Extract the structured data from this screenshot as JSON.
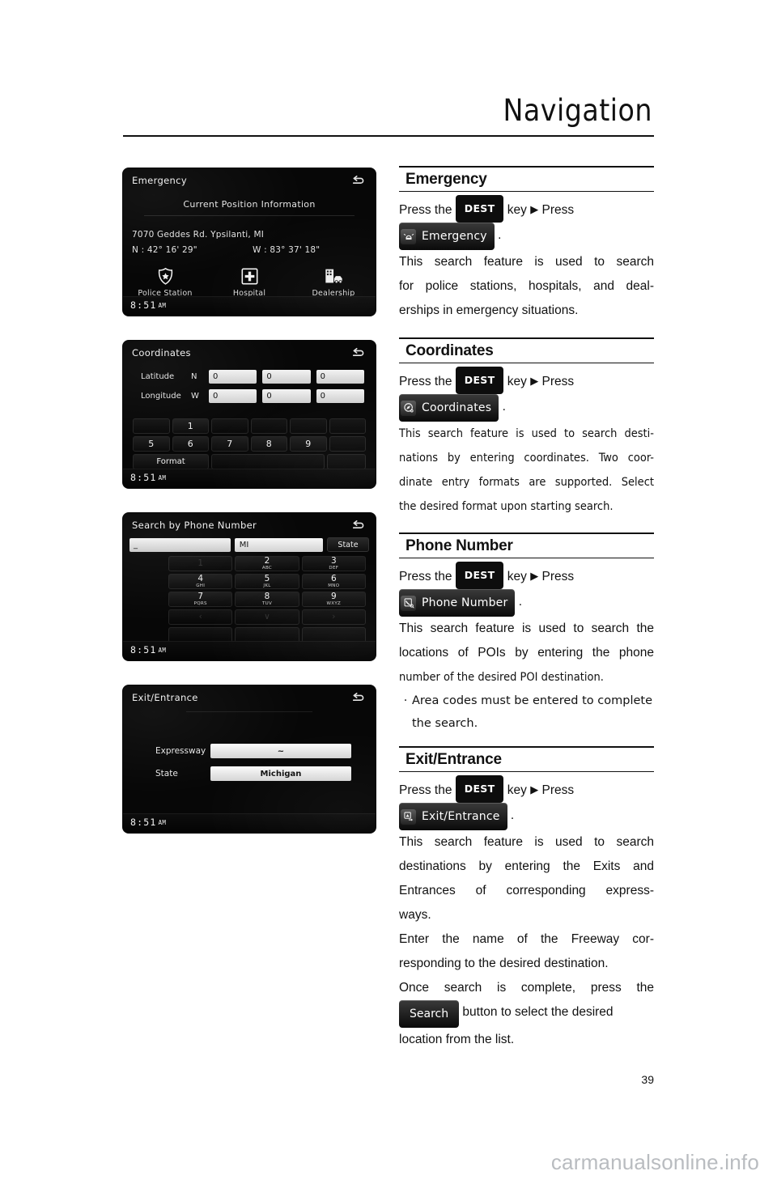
{
  "page": {
    "title": "Navigation",
    "number": "39",
    "watermark": "carmanualsonline.info"
  },
  "shots": {
    "emergency": {
      "title": "Emergency",
      "subtitle": "Current Position Information",
      "address": "7070 Geddes Rd. Ypsilanti, MI",
      "latitude": "N : 42° 16' 29\"",
      "longitude": "W : 83° 37' 18\"",
      "clock": "8:51",
      "clock_ampm": "AM",
      "items": [
        {
          "label": "Police Station",
          "icon": "police-badge-icon"
        },
        {
          "label": "Hospital",
          "icon": "hospital-cross-icon"
        },
        {
          "label": "Dealership",
          "icon": "dealership-icon"
        }
      ],
      "back_icon": "back-arrow-icon"
    },
    "coordinates": {
      "title": "Coordinates",
      "clock": "8:51",
      "clock_ampm": "AM",
      "rows": [
        {
          "label": "Latitude",
          "dir": "N",
          "values": [
            "0",
            "0",
            "0"
          ]
        },
        {
          "label": "Longitude",
          "dir": "W",
          "values": [
            "0",
            "0",
            "0"
          ]
        }
      ],
      "keypad_row1": [
        "",
        "1",
        "",
        "",
        "",
        ""
      ],
      "keypad_row2": [
        "5",
        "6",
        "7",
        "8",
        "9",
        ""
      ],
      "format_label": "Format",
      "back_icon": "back-arrow-icon"
    },
    "phone": {
      "title": "Search by Phone Number",
      "number_value": "_",
      "state_value": "MI",
      "state_button": "State",
      "clock": "8:51",
      "clock_ampm": "AM",
      "keys": [
        {
          "num": "1",
          "sub": "",
          "dim": true
        },
        {
          "num": "2",
          "sub": "ABC",
          "dim": false
        },
        {
          "num": "3",
          "sub": "DEF",
          "dim": false
        },
        {
          "num": "4",
          "sub": "GHI",
          "dim": false
        },
        {
          "num": "5",
          "sub": "JKL",
          "dim": false
        },
        {
          "num": "6",
          "sub": "MNO",
          "dim": false
        },
        {
          "num": "7",
          "sub": "PQRS",
          "dim": false
        },
        {
          "num": "8",
          "sub": "TUV",
          "dim": false
        },
        {
          "num": "9",
          "sub": "WXYZ",
          "dim": false
        },
        {
          "num": "‹",
          "sub": "",
          "dim": true
        },
        {
          "num": "∨",
          "sub": "",
          "dim": true
        },
        {
          "num": "›",
          "sub": "",
          "dim": true
        }
      ],
      "back_icon": "back-arrow-icon"
    },
    "exit_entrance": {
      "title": "Exit/Entrance",
      "clock": "8:51",
      "clock_ampm": "AM",
      "rows": [
        {
          "label": "Expressway",
          "value": "~"
        },
        {
          "label": "State",
          "value": "Michigan"
        }
      ],
      "back_icon": "back-arrow-icon"
    }
  },
  "sections": {
    "emergency": {
      "heading": "Emergency",
      "press_the": "Press the",
      "dest_key": "DEST",
      "key_word": "key",
      "arrow": "▶",
      "press2": "Press",
      "badge_label": "Emergency",
      "badge_icon": "siren-icon",
      "period": ".",
      "lines": [
        "This search feature is used to search",
        "for police stations, hospitals, and deal-",
        "erships in emergency situations."
      ]
    },
    "coordinates": {
      "heading": "Coordinates",
      "press_the": "Press the",
      "dest_key": "DEST",
      "key_word": "key",
      "arrow": "▶",
      "press2": "Press",
      "badge_label": "Coordinates",
      "badge_icon": "compass-icon",
      "period": ".",
      "lines": [
        "This search feature is used to search desti-",
        "nations by entering coordinates. Two coor-",
        "dinate entry formats are supported. Select",
        "the desired format upon starting search."
      ]
    },
    "phone_number": {
      "heading": "Phone Number",
      "press_the": "Press the",
      "dest_key": "DEST",
      "key_word": "key",
      "arrow": "▶",
      "press2": "Press",
      "badge_label": "Phone Number",
      "badge_icon": "phone-search-icon",
      "period": ".",
      "lines": [
        "This search feature is used to search the",
        "locations of POIs by entering the phone",
        "number of the desired POI destination."
      ],
      "bullet": {
        "dot": "·",
        "lines": [
          "Area codes must be entered to complete",
          "the search."
        ]
      }
    },
    "exit_entrance": {
      "heading": "Exit/Entrance",
      "press_the": "Press the",
      "dest_key": "DEST",
      "key_word": "key",
      "arrow": "▶",
      "press2": "Press",
      "badge_label": "Exit/Entrance",
      "badge_icon": "exit-entrance-icon",
      "period": ".",
      "lines": [
        "This search feature is used to search",
        "destinations by entering the Exits and",
        "Entrances of corresponding express-",
        "ways.",
        "Enter the name of the Freeway cor-",
        "responding to the desired destination.",
        "Once search is complete, press the"
      ],
      "search_badge": "Search",
      "after_badge_1": "button to select the desired",
      "after_badge_2": "location from the list."
    }
  }
}
